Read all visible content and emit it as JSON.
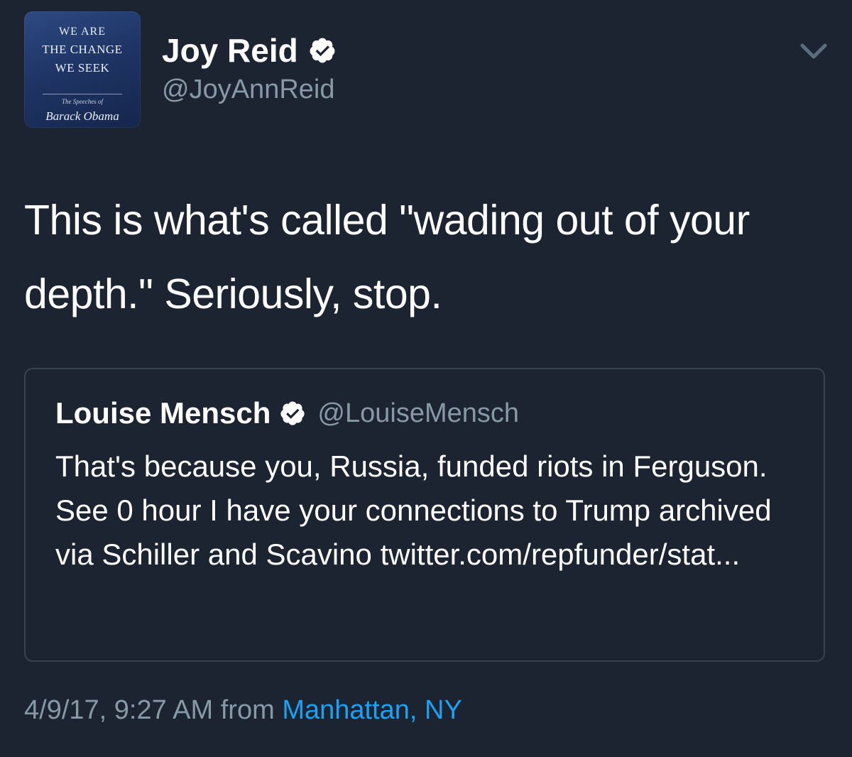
{
  "tweet": {
    "avatar": {
      "line1": "WE ARE",
      "line2": "THE CHANGE",
      "line3": "WE SEEK",
      "line4": "The Speeches of",
      "line5": "Barack Obama"
    },
    "display_name": "Joy Reid",
    "handle": "@JoyAnnReid",
    "text": "This is what's called \"wading out of your depth.\" Seriously, stop.",
    "quote": {
      "display_name": "Louise Mensch",
      "handle": "@LouiseMensch",
      "text": "That's because you, Russia, funded riots in Ferguson. See 0 hour I have your connections to Trump archived via Schiller and Scavino twitter.com/repfunder/stat..."
    },
    "timestamp": "4/9/17, 9:27 AM",
    "from_label": "from",
    "location": "Manhattan, NY"
  },
  "colors": {
    "background": "#1b2430",
    "text": "#ffffff",
    "secondary_text": "#8899a6",
    "link": "#1da1f2",
    "card_border": "#38444d"
  }
}
